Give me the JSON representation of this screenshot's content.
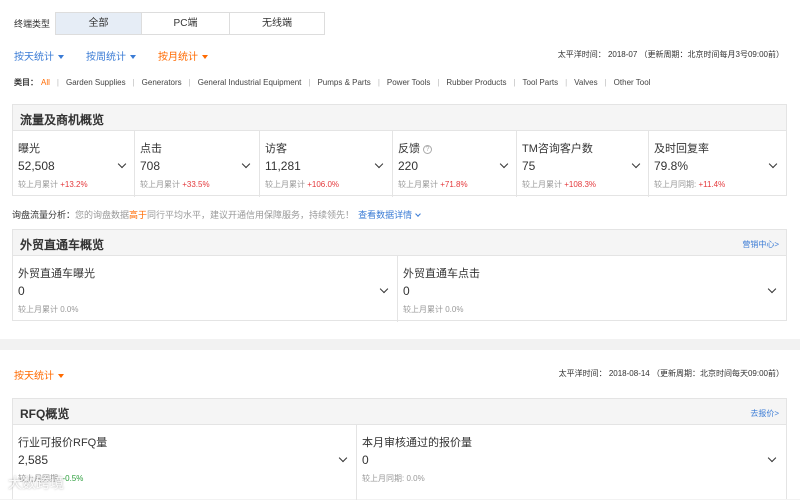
{
  "terminal": {
    "label": "终端类型",
    "options": [
      "全部",
      "PC端",
      "无线端"
    ],
    "selected": "全部"
  },
  "period_tabs": [
    {
      "label": "按天统计"
    },
    {
      "label": "按周统计"
    },
    {
      "label": "按月统计"
    }
  ],
  "time_info": "太平洋时间： 2018-07 （更新周期：北京时间每月3号09:00前）",
  "categories": {
    "label": "类目：",
    "items": [
      "All",
      "Garden Supplies",
      "Generators",
      "General Industrial Equipment",
      "Pumps & Parts",
      "Power Tools",
      "Rubber Products",
      "Tool Parts",
      "Valves",
      "Other Tool"
    ],
    "selected": "All"
  },
  "traffic": {
    "title": "流量及商机概览",
    "metrics": [
      {
        "label": "曝光",
        "value": "52,508",
        "sub_prefix": "较上月累计",
        "change": "+13.2%",
        "trend": "up"
      },
      {
        "label": "点击",
        "value": "708",
        "sub_prefix": "较上月累计",
        "change": "+33.5%",
        "trend": "up"
      },
      {
        "label": "访客",
        "value": "11,281",
        "sub_prefix": "较上月累计",
        "change": "+106.0%",
        "trend": "up"
      },
      {
        "label": "反馈",
        "value": "220",
        "sub_prefix": "较上月累计",
        "change": "+71.8%",
        "trend": "up"
      },
      {
        "label": "TM咨询客户数",
        "value": "75",
        "sub_prefix": "较上月累计",
        "change": "+108.3%",
        "trend": "up"
      },
      {
        "label": "及时回复率",
        "value": "79.8%",
        "sub_prefix": "较上月同期:",
        "change": "+11.4%",
        "trend": "up"
      }
    ]
  },
  "analysis": {
    "label": "询盘流量分析：",
    "text_before": "您的询盘数据",
    "highlight": "高于",
    "text_after": "同行平均水平，建议开通信用保障服务，持续领先！",
    "link": "查看数据详情"
  },
  "p4p": {
    "title": "外贸直通车概览",
    "link": "营销中心>",
    "metrics": [
      {
        "label": "外贸直通车曝光",
        "value": "0",
        "sub_prefix": "较上月累计",
        "change": "0.0%",
        "trend": "none"
      },
      {
        "label": "外贸直通车点击",
        "value": "0",
        "sub_prefix": "较上月累计",
        "change": "0.0%",
        "trend": "none"
      }
    ]
  },
  "rfq_period": {
    "label": "按天统计"
  },
  "rfq_time_info": "太平洋时间： 2018-08-14 （更新周期：北京时间每天09:00前）",
  "rfq": {
    "title": "RFQ概览",
    "link": "去报价>",
    "metrics": [
      {
        "label": "行业可报价RFQ量",
        "value": "2,585",
        "sub_prefix": "较上月同期:",
        "change": "-0.5%",
        "trend": "down"
      },
      {
        "label": "本月审核通过的报价量",
        "value": "0",
        "sub_prefix": "较上月同期:",
        "change": "0.0%",
        "trend": "none"
      }
    ]
  },
  "watermark": "大数跨境",
  "colors": {
    "accent_blue": "#3a7bd5",
    "accent_orange": "#ff6a00",
    "up_red": "#e4393c",
    "down_green": "#2a9d3a"
  }
}
